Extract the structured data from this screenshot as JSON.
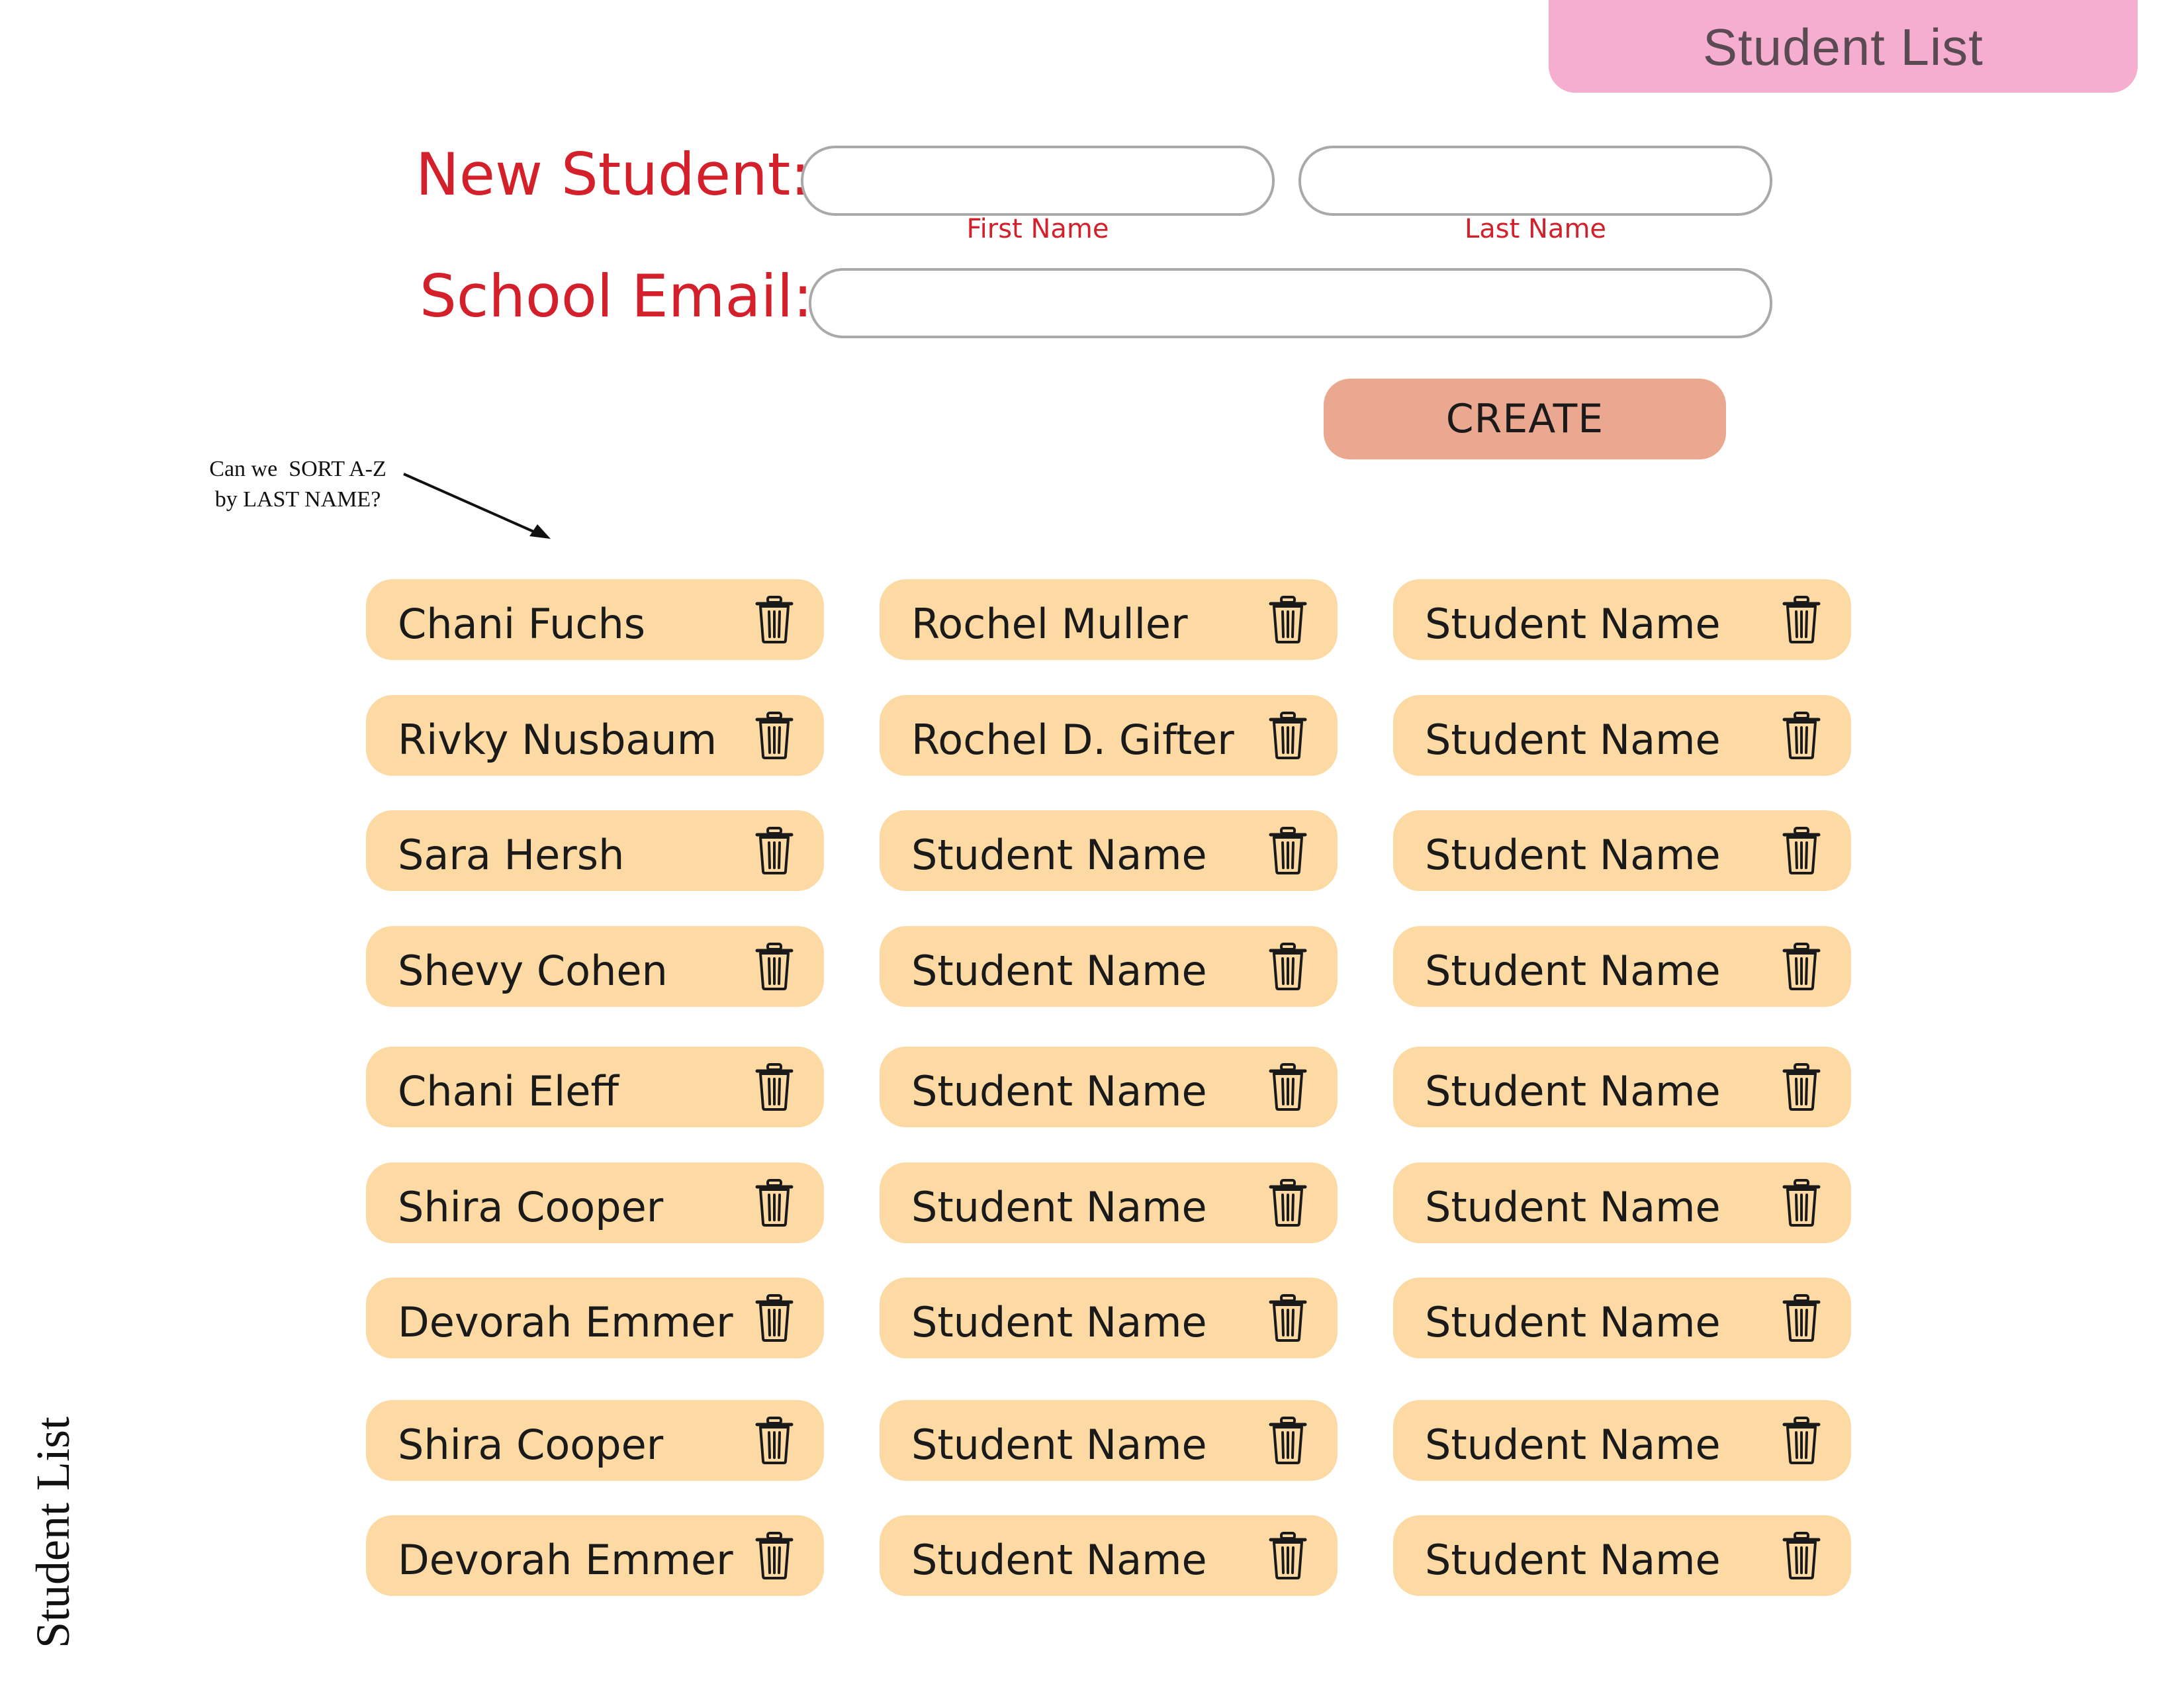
{
  "header": {
    "title": "Student List"
  },
  "form": {
    "new_student_label": "New Student:",
    "first_name": {
      "value": "",
      "caption": "First Name"
    },
    "last_name": {
      "value": "",
      "caption": "Last Name"
    },
    "email_label": "School Email:",
    "email": {
      "value": ""
    },
    "create_label": "CREATE"
  },
  "annotation": {
    "line1": "Can we  SORT A-Z",
    "line2": "by LAST NAME?"
  },
  "students": [
    [
      "Chani Fuchs",
      "Rochel Muller",
      "Student Name"
    ],
    [
      "Rivky Nusbaum",
      "Rochel D. Gifter",
      "Student Name"
    ],
    [
      "Sara Hersh",
      "Student Name",
      "Student Name"
    ],
    [
      "Shevy Cohen",
      "Student Name",
      "Student Name"
    ],
    [
      "Chani Eleff",
      "Student Name",
      "Student Name"
    ],
    [
      "Shira Cooper",
      "Student Name",
      "Student Name"
    ],
    [
      "Devorah Emmer",
      "Student Name",
      "Student Name"
    ],
    [
      "Shira Cooper",
      "Student Name",
      "Student Name"
    ],
    [
      "Devorah Emmer",
      "Student Name",
      "Student Name"
    ]
  ],
  "icons": {
    "delete": "trash-icon"
  },
  "colors": {
    "header_tab": "#f5aed0",
    "label_red": "#d4202a",
    "create_button": "#eba891",
    "student_card": "#fddaa3"
  },
  "side_label": "Student List"
}
